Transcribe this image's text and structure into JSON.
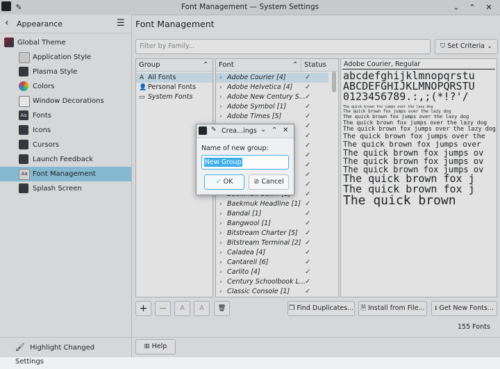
{
  "window": {
    "title": "Font Management — System Settings"
  },
  "sidebar": {
    "back_label": "Appearance",
    "items": [
      {
        "label": "Global Theme",
        "icon": "global-theme-icon"
      },
      {
        "label": "Application Style",
        "icon": "app-style-icon"
      },
      {
        "label": "Plasma Style",
        "icon": "plasma-style-icon"
      },
      {
        "label": "Colors",
        "icon": "colors-icon"
      },
      {
        "label": "Window Decorations",
        "icon": "window-decorations-icon"
      },
      {
        "label": "Fonts",
        "icon": "fonts-icon"
      },
      {
        "label": "Icons",
        "icon": "icons-icon"
      },
      {
        "label": "Cursors",
        "icon": "cursors-icon"
      },
      {
        "label": "Launch Feedback",
        "icon": "launch-feedback-icon"
      },
      {
        "label": "Font Management",
        "icon": "font-management-icon"
      },
      {
        "label": "Splash Screen",
        "icon": "splash-screen-icon"
      }
    ],
    "highlight_label": "Highlight Changed Settings"
  },
  "page": {
    "title": "Font Management",
    "filter_placeholder": "Filter by Family...",
    "set_criteria_label": "Set Criteria",
    "group_header": "Group",
    "groups": [
      {
        "label": "All Fonts",
        "icon": "A"
      },
      {
        "label": "Personal Fonts",
        "icon": "person"
      },
      {
        "label": "System Fonts",
        "icon": "monitor"
      }
    ],
    "font_header": "Font",
    "status_header": "Status",
    "fonts": [
      "Adobe Courier [4]",
      "Adobe Helvetica [4]",
      "Adobe New Century S...",
      "Adobe Symbol [1]",
      "Adobe Times [5]",
      "",
      "",
      "",
      "",
      "",
      "",
      "",
      "Baekmuk Gulim [1]",
      "Baekmuk Headline [1]",
      "Bandal [1]",
      "Bangwool [1]",
      "Bitstream Charter [5]",
      "Bitstream Terminal [2]",
      "Caladea [4]",
      "Cantarell [6]",
      "Carlito [4]",
      "Century Schoolbook L...",
      "Classic Console [1]"
    ],
    "preview_title": "Adobe Courier, Regular",
    "preview_lines": [
      "abcdefghijklmnopqrstu",
      "ABCDEFGHIJKLMNOPQRSTU",
      "0123456789.:,;(*!?'/",
      "The quick brown fox jumps over the lazy dog",
      "The quick brown fox jumps over the lazy dog",
      "The quick brown fox jumps over the lazy dog",
      "The quick brown fox jumps over the lazy dog",
      "The quick brown fox jumps over the lazy dog",
      "The quick brown fox jumps over the",
      "The quick brown fox jumps over",
      "The quick brown fox jumps ov",
      "The quick brown fox jumps ov",
      "The quick brown fox jumps ov",
      "The quick brown fox j",
      "The quick brown fox j",
      "The quick brown"
    ],
    "find_duplicates_label": "Find Duplicates...",
    "install_label": "Install from File...",
    "get_new_label": "Get New Fonts...",
    "font_count": "155 Fonts",
    "help_label": "Help"
  },
  "dialog": {
    "title": "Crea...ings",
    "prompt": "Name of new group:",
    "input_value": "New Group",
    "ok_label": "OK",
    "cancel_label": "Cancel"
  },
  "colors": {
    "selection": "#93cee9",
    "accent": "#3daee9"
  }
}
